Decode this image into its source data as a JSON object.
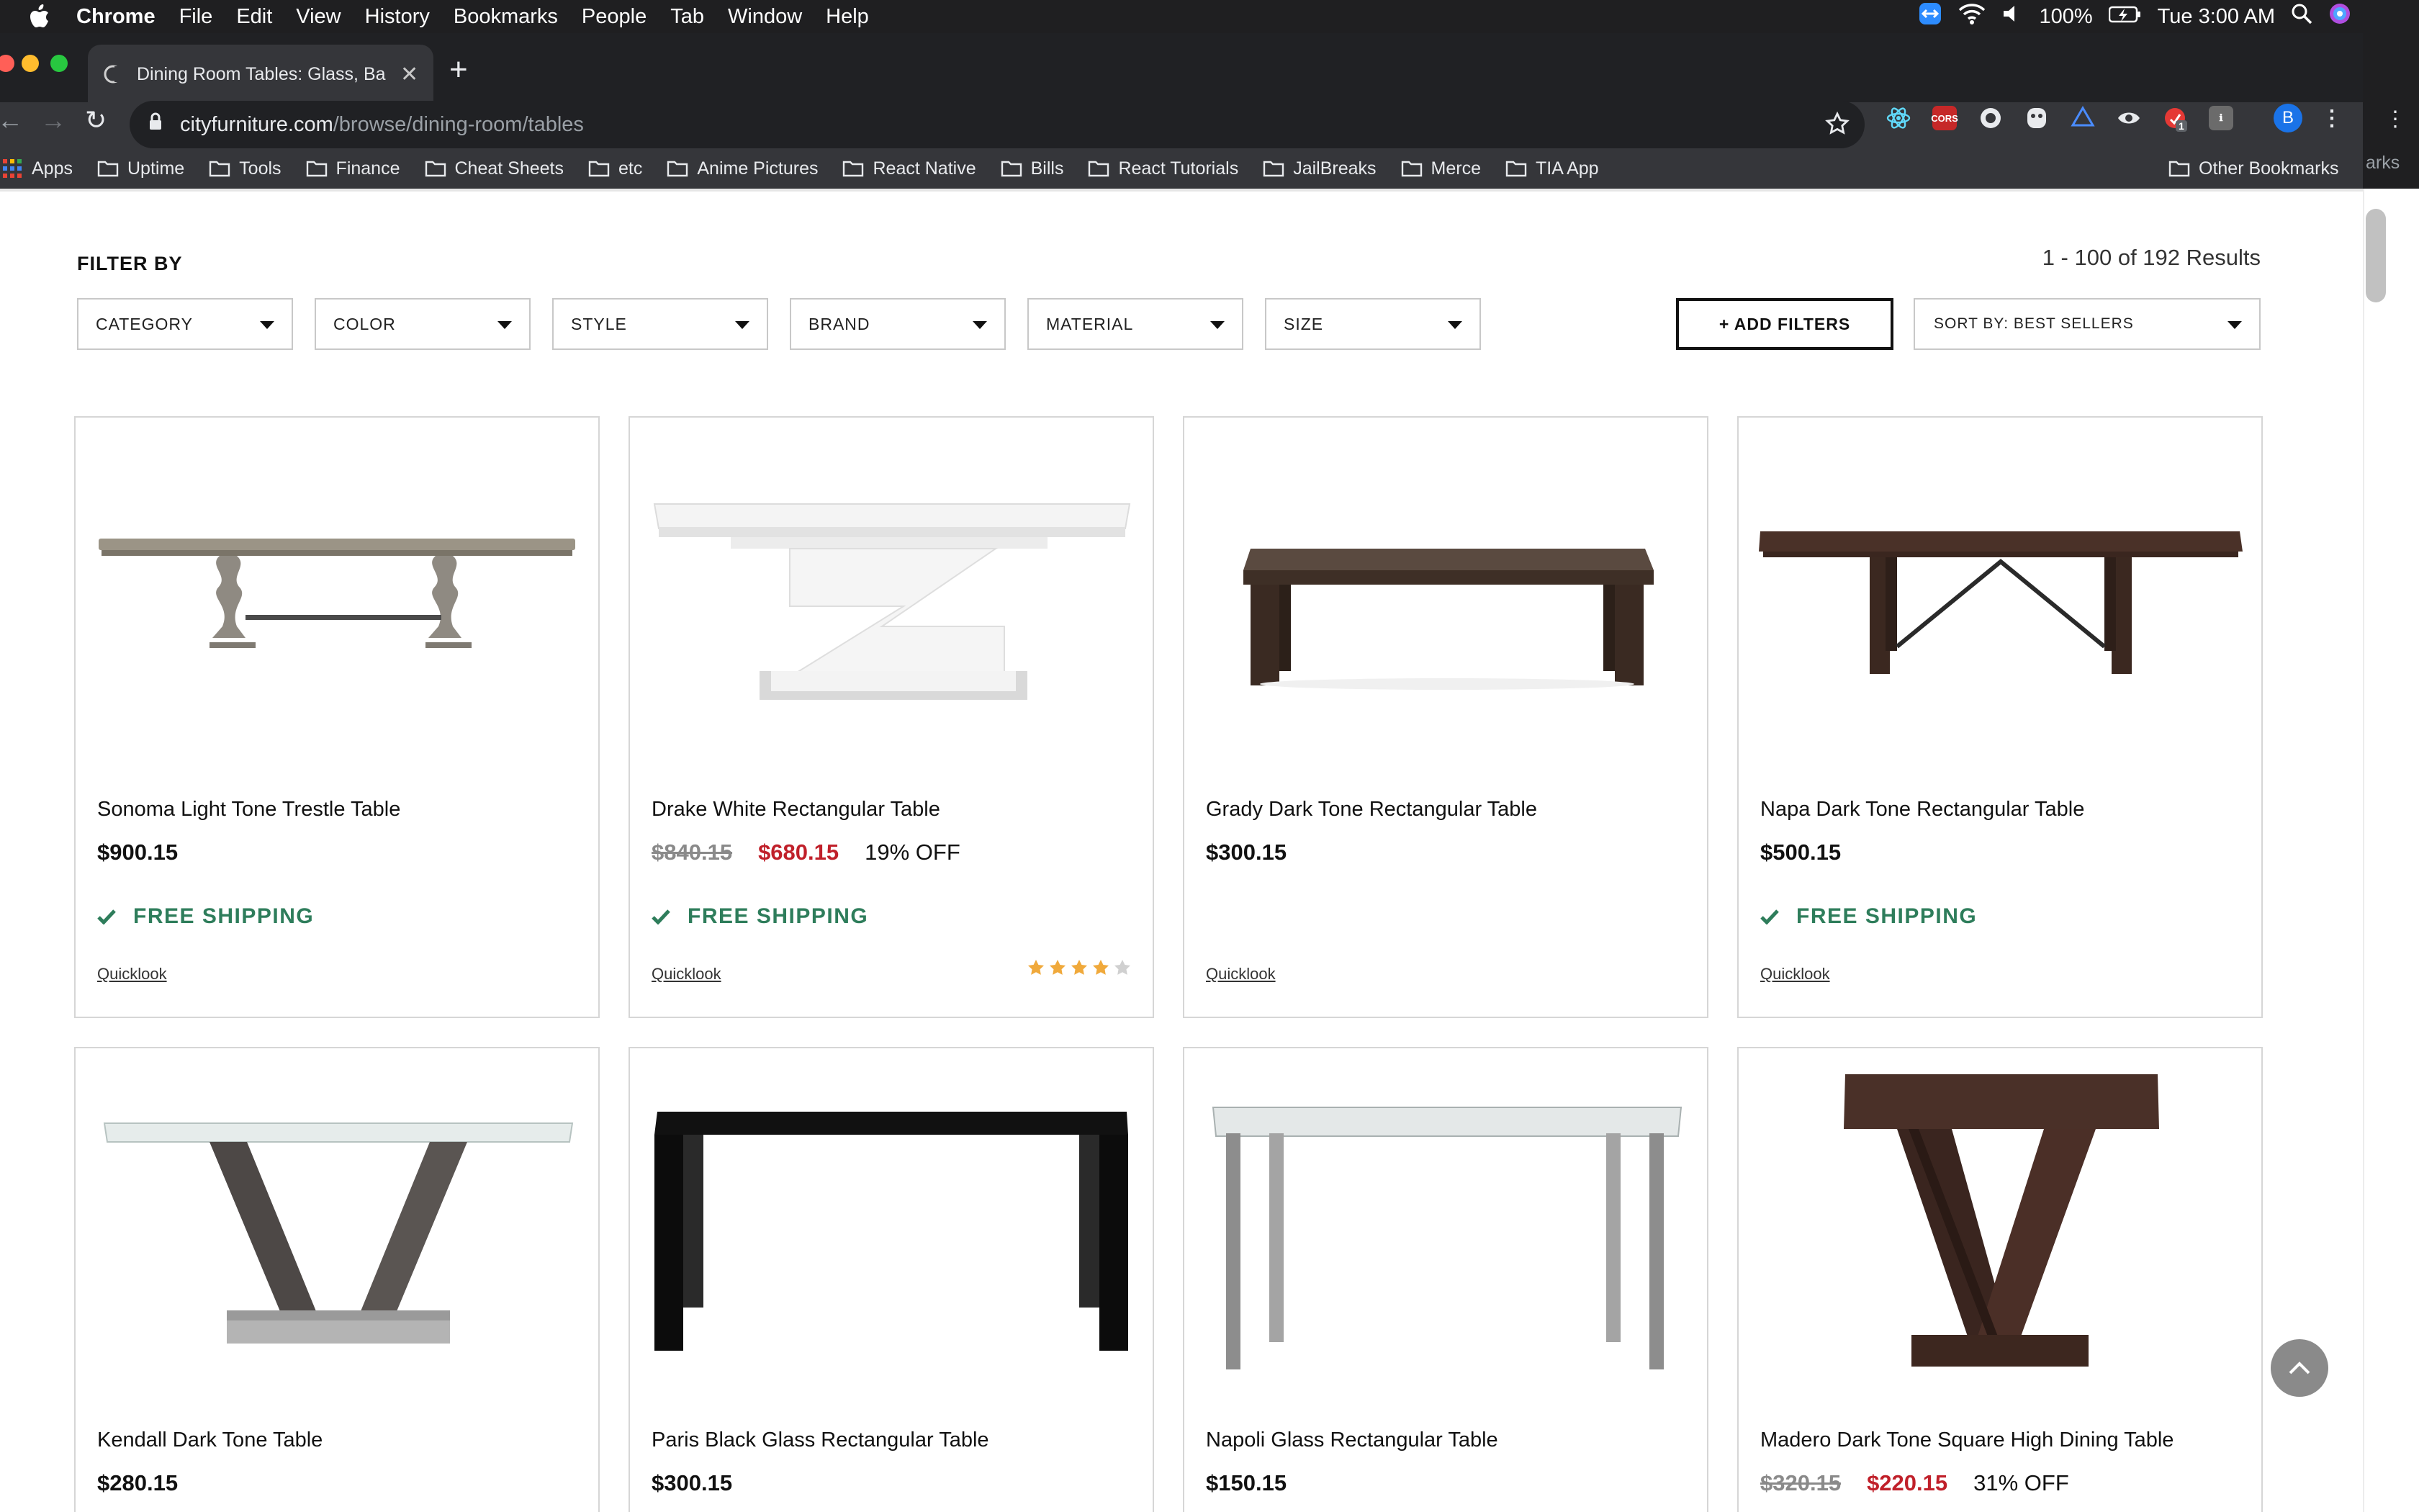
{
  "menubar": {
    "app": "Chrome",
    "items": [
      "File",
      "Edit",
      "View",
      "History",
      "Bookmarks",
      "People",
      "Tab",
      "Window",
      "Help"
    ],
    "battery": "100%",
    "clock": "Tue 3:00 AM"
  },
  "browser": {
    "tab_title": "Dining Room Tables: Glass, Ba",
    "url_host": "cityfurniture.com",
    "url_path": "/browse/dining-room/tables",
    "avatar_initial": "B",
    "ext_badge": "1",
    "bookmarks": [
      "Apps",
      "Uptime",
      "Tools",
      "Finance",
      "Cheat Sheets",
      "etc",
      "Anime Pictures",
      "React Native",
      "Bills",
      "React Tutorials",
      "JailBreaks",
      "Merce",
      "TIA App"
    ],
    "other_bookmarks": "Other Bookmarks",
    "right_strip_text": "arks"
  },
  "filters": {
    "heading": "FILTER BY",
    "results": "1 - 100 of 192 Results",
    "dropdowns": [
      "CATEGORY",
      "COLOR",
      "STYLE",
      "BRAND",
      "MATERIAL",
      "SIZE"
    ],
    "add_filters": "+ ADD FILTERS",
    "sort": "SORT BY: BEST SELLERS"
  },
  "products": [
    {
      "name": "Sonoma Light Tone Trestle Table",
      "price": "$900.15",
      "shipping": "FREE SHIPPING",
      "quicklook": "Quicklook"
    },
    {
      "name": "Drake White Rectangular Table",
      "was": "$840.15",
      "sale": "$680.15",
      "off": "19% OFF",
      "shipping": "FREE SHIPPING",
      "quicklook": "Quicklook",
      "rating": 4
    },
    {
      "name": "Grady Dark Tone Rectangular Table",
      "price": "$300.15",
      "quicklook": "Quicklook"
    },
    {
      "name": "Napa Dark Tone Rectangular Table",
      "price": "$500.15",
      "shipping": "FREE SHIPPING",
      "quicklook": "Quicklook"
    },
    {
      "name": "Kendall Dark Tone Table",
      "price": "$280.15"
    },
    {
      "name": "Paris Black Glass Rectangular Table",
      "price": "$300.15"
    },
    {
      "name": "Napoli Glass Rectangular Table",
      "price": "$150.15"
    },
    {
      "name": "Madero Dark Tone Square High Dining Table",
      "was": "$320.15",
      "sale": "$220.15",
      "off": "31% OFF"
    }
  ],
  "colors": {
    "shipping_green": "#2e7d5b",
    "sale_red": "#c0202a",
    "star_gold": "#f0a93b"
  }
}
